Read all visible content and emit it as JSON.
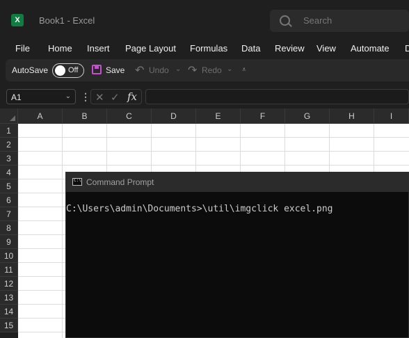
{
  "excel": {
    "window_title": "Book1 - Excel",
    "logo_letter": "X",
    "search_placeholder": "Search",
    "menu": [
      "File",
      "Home",
      "Insert",
      "Page Layout",
      "Formulas",
      "Data",
      "Review",
      "View",
      "Automate",
      "D"
    ],
    "toolbar": {
      "autosave_label": "AutoSave",
      "autosave_state": "Off",
      "save_label": "Save",
      "undo_label": "Undo",
      "redo_label": "Redo"
    },
    "name_box": "A1",
    "formula_value": "",
    "columns": [
      "A",
      "B",
      "C",
      "D",
      "E",
      "F",
      "G",
      "H",
      "I"
    ],
    "rows": [
      "1",
      "2",
      "3",
      "4",
      "5",
      "6",
      "7",
      "8",
      "9",
      "10",
      "11",
      "12",
      "13",
      "14",
      "15"
    ],
    "colors": {
      "brand": "#107c41",
      "save_icon": "#c44fcf"
    }
  },
  "cmd": {
    "title": "Command Prompt",
    "line": "C:\\Users\\admin\\Documents>\\util\\imgclick excel.png"
  }
}
